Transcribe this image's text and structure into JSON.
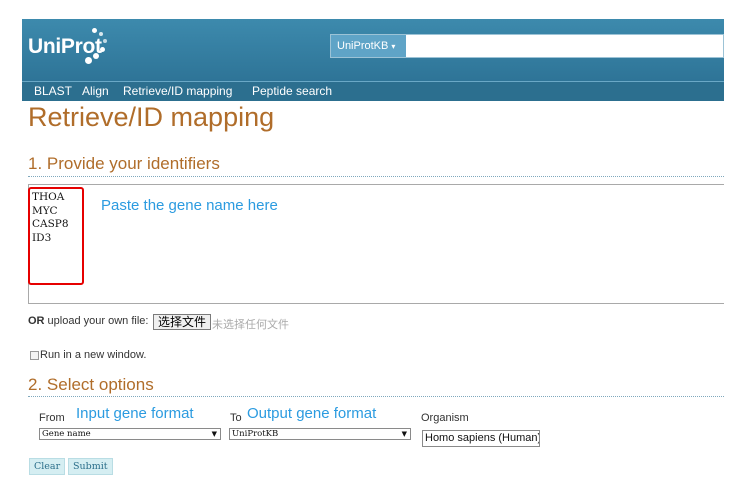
{
  "header": {
    "logo_text": "UniProt",
    "search": {
      "db_select": "UniProtKB",
      "placeholder": ""
    }
  },
  "nav": {
    "items": [
      "BLAST",
      "Align",
      "Retrieve/ID mapping",
      "Peptide search"
    ]
  },
  "page_title": "Retrieve/ID mapping",
  "section1": {
    "title": "1. Provide your identifiers",
    "identifiers": [
      "THOA",
      "MYC",
      "CASP8",
      "ID3"
    ],
    "annotation": "Paste the gene name here"
  },
  "upload": {
    "or_label": "OR",
    "label_rest": " upload your own file:",
    "button_label": "选择文件",
    "status": "未选择任何文件"
  },
  "run_new_window_label": "Run in a new window.",
  "section2": {
    "title": "2. Select options",
    "from_label": "From",
    "from_annotation": "Input gene format",
    "from_value": "Gene name",
    "to_label": "To",
    "to_annotation": "Output gene format",
    "to_value": "UniProtKB",
    "organism_label": "Organism",
    "organism_value": "Homo sapiens (Human)"
  },
  "buttons": {
    "clear": "Clear",
    "submit": "Submit"
  },
  "colors": {
    "header": "#3d8aad",
    "nav": "#2c6f8f",
    "title": "#b06d2a",
    "annotation": "#2b9be0",
    "highlight": "#e60000"
  }
}
